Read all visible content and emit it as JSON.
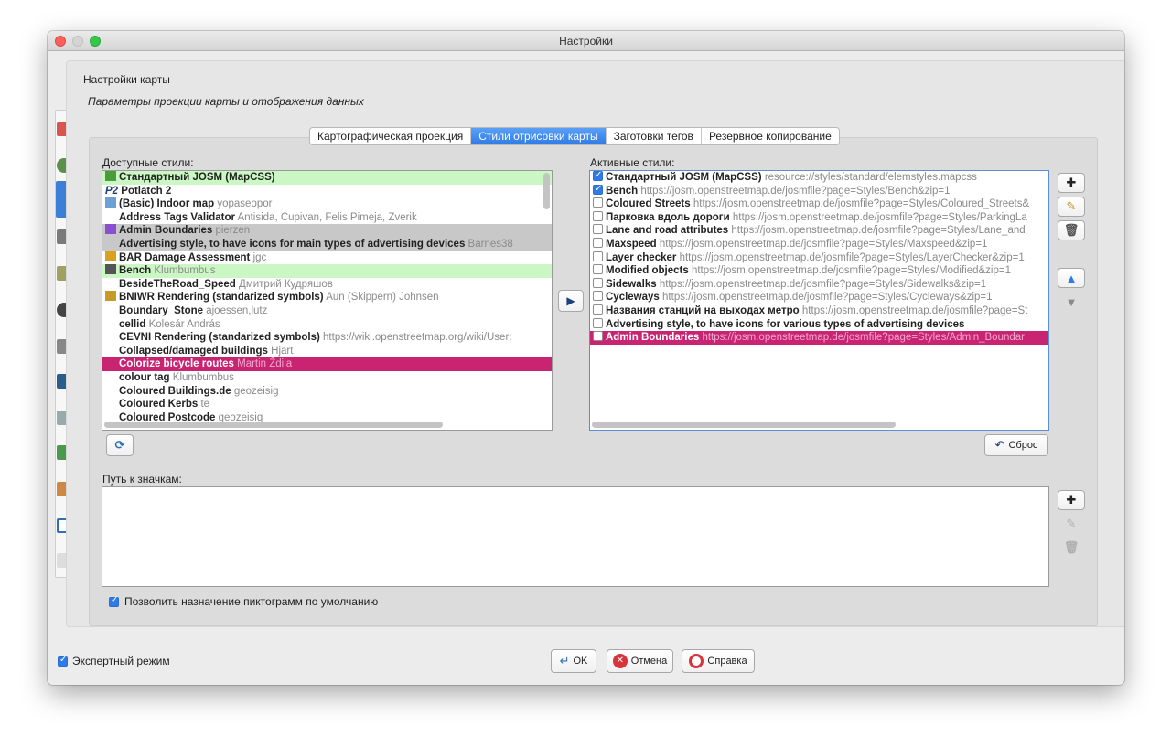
{
  "window": {
    "title": "Настройки"
  },
  "header": {
    "title": "Настройки карты",
    "subtitle": "Параметры проекции карты и отображения данных"
  },
  "tabs": [
    {
      "label": "Картографическая проекция"
    },
    {
      "label": "Стили отрисовки карты",
      "selected": true
    },
    {
      "label": "Заготовки тегов"
    },
    {
      "label": "Резервное копирование"
    }
  ],
  "available": {
    "label": "Доступные стили:",
    "items": [
      {
        "name": "Стандартный JOSM (MapCSS)",
        "author": "",
        "style": "green",
        "icon": "josm-icon"
      },
      {
        "name": "Potlatch 2",
        "author": "",
        "style": "",
        "icon": "p2-icon",
        "prefix": "P2"
      },
      {
        "name": "(Basic) Indoor map",
        "author": "yopaseopor",
        "style": "",
        "icon": "indoor-icon"
      },
      {
        "name": "Address Tags Validator",
        "author": "Antisida, Cupivan, Felis Pimeja, Zverik",
        "style": "",
        "icon": ""
      },
      {
        "name": "Admin Boundaries",
        "author": "pierzen",
        "style": "gray",
        "icon": "boundary-icon"
      },
      {
        "name": "Advertising style, to have icons for main types of advertising devices",
        "author": "Barnes38",
        "style": "gray",
        "icon": ""
      },
      {
        "name": "BAR Damage Assessment",
        "author": "jgc",
        "style": "",
        "icon": "damage-icon"
      },
      {
        "name": "Bench",
        "author": "Klumbumbus",
        "style": "green",
        "icon": "bench-icon"
      },
      {
        "name": "BesideTheRoad_Speed",
        "author": "Дмитрий Кудряшов",
        "style": "",
        "icon": ""
      },
      {
        "name": "BNIWR Rendering (standarized symbols)",
        "author": "Aun (Skippern) Johnsen",
        "style": "",
        "icon": "bniwr-icon"
      },
      {
        "name": "Boundary_Stone",
        "author": "ajoessen,lutz",
        "style": "",
        "icon": ""
      },
      {
        "name": "cellid",
        "author": "Kolesár András",
        "style": "",
        "icon": ""
      },
      {
        "name": "CEVNI Rendering (standarized symbols)",
        "author": "https://wiki.openstreetmap.org/wiki/User:",
        "style": "",
        "icon": ""
      },
      {
        "name": "Collapsed/damaged buildings",
        "author": "Hjart",
        "style": "",
        "icon": ""
      },
      {
        "name": "Colorize bicycle routes",
        "author": "Martin Ždila",
        "style": "pink",
        "icon": ""
      },
      {
        "name": "colour tag",
        "author": "Klumbumbus",
        "style": "",
        "icon": ""
      },
      {
        "name": "Coloured Buildings.de",
        "author": "geozeisig",
        "style": "",
        "icon": ""
      },
      {
        "name": "Coloured Kerbs",
        "author": "te",
        "style": "",
        "icon": ""
      },
      {
        "name": "Coloured Postcode",
        "author": "geozeisig",
        "style": "",
        "icon": ""
      }
    ]
  },
  "active": {
    "label": "Активные стили:",
    "items": [
      {
        "name": "Стандартный JOSM (MapCSS)",
        "url": "resource://styles/standard/elemstyles.mapcss",
        "checked": true,
        "style": ""
      },
      {
        "name": "Bench",
        "url": "https://josm.openstreetmap.de/josmfile?page=Styles/Bench&zip=1",
        "checked": true,
        "style": ""
      },
      {
        "name": "Coloured Streets",
        "url": "https://josm.openstreetmap.de/josmfile?page=Styles/Coloured_Streets&",
        "checked": false,
        "style": ""
      },
      {
        "name": "Парковка вдоль дороги",
        "url": "https://josm.openstreetmap.de/josmfile?page=Styles/ParkingLa",
        "checked": false,
        "style": ""
      },
      {
        "name": "Lane and road attributes",
        "url": "https://josm.openstreetmap.de/josmfile?page=Styles/Lane_and",
        "checked": false,
        "style": ""
      },
      {
        "name": "Maxspeed",
        "url": "https://josm.openstreetmap.de/josmfile?page=Styles/Maxspeed&zip=1",
        "checked": false,
        "style": ""
      },
      {
        "name": "Layer checker",
        "url": "https://josm.openstreetmap.de/josmfile?page=Styles/LayerChecker&zip=1",
        "checked": false,
        "style": ""
      },
      {
        "name": "Modified objects",
        "url": "https://josm.openstreetmap.de/josmfile?page=Styles/Modified&zip=1",
        "checked": false,
        "style": ""
      },
      {
        "name": "Sidewalks",
        "url": "https://josm.openstreetmap.de/josmfile?page=Styles/Sidewalks&zip=1",
        "checked": false,
        "style": ""
      },
      {
        "name": "Cycleways",
        "url": "https://josm.openstreetmap.de/josmfile?page=Styles/Cycleways&zip=1",
        "checked": false,
        "style": ""
      },
      {
        "name": "Названия станций на выходах метро",
        "url": "https://josm.openstreetmap.de/josmfile?page=St",
        "checked": false,
        "style": ""
      },
      {
        "name": "Advertising style, to have icons for various types of advertising devices",
        "url": "",
        "checked": false,
        "style": ""
      },
      {
        "name": "Admin Boundaries",
        "url": "https://josm.openstreetmap.de/josmfile?page=Styles/Admin_Boundar",
        "checked": false,
        "style": "pink"
      }
    ]
  },
  "icons": {
    "label": "Путь к значкам:",
    "allow_default_label": "Позволить назначение пиктограмм по умолчанию",
    "allow_default_checked": true
  },
  "reset_label": "Сброс",
  "footer": {
    "expert_mode_label": "Экспертный режим",
    "expert_mode_checked": true,
    "ok_label": "OK",
    "cancel_label": "Отмена",
    "help_label": "Справка"
  },
  "colors": {
    "accent": "#2f7be6",
    "green_row": "#cbf7c4",
    "gray_row": "#c8c8c8",
    "pink_row": "#c82472"
  }
}
